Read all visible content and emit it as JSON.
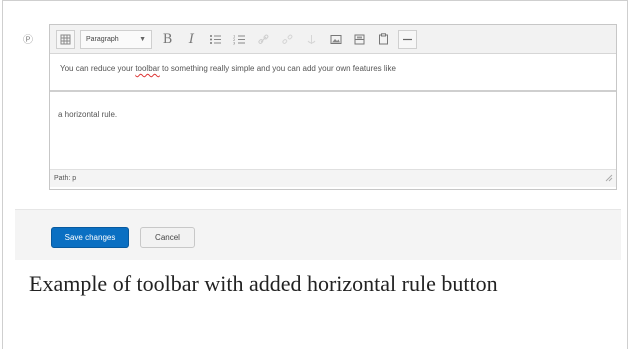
{
  "editor": {
    "help_icon": "?",
    "toolbar": {
      "format_select": "Paragraph",
      "bold_label": "B",
      "italic_label": "I",
      "icons": [
        "toggle-toolbar-icon",
        "bullet-list-icon",
        "numbered-list-icon",
        "link-icon",
        "unlink-icon",
        "anchor-icon",
        "image-icon",
        "media-icon",
        "paste-icon",
        "horizontal-rule-icon"
      ]
    },
    "content_line1_before": "You can reduce your ",
    "content_line1_misspelled": "toolbar",
    "content_line1_after": " to something really simple and you can add your own features like",
    "content_line2": "a horizontal rule.",
    "path_label": "Path: p"
  },
  "form": {
    "save_label": "Save changes",
    "cancel_label": "Cancel"
  },
  "caption": "Example of toolbar with added horizontal rule button",
  "colors": {
    "save_button": "#0a6fc2",
    "toolbar_bg": "#f2f2f2"
  }
}
